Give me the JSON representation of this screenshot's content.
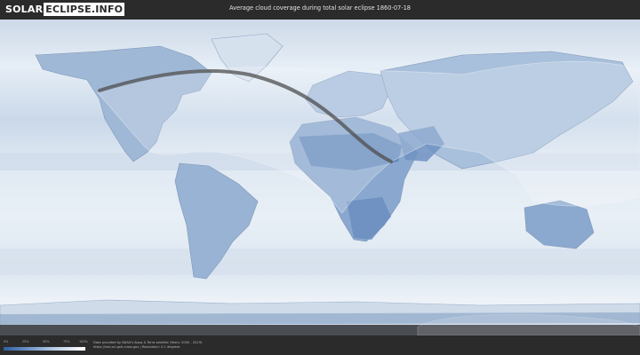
{
  "header": {
    "logo_part1": "SOLAR",
    "logo_part2": "ECLIPSE.INFO",
    "title": "Average cloud coverage during total solar eclipse 1860-07-18"
  },
  "legend": {
    "ticks": [
      "0%",
      "25%",
      "50%",
      "75%",
      "100%"
    ],
    "colors": {
      "low": "#2f5e9e",
      "mid": "#b3c9e2",
      "high": "#ffffff"
    }
  },
  "footer": {
    "credit_line1": "Data provided by NASA's Aqua & Terra satellite (Years: 2000 - 2019)",
    "credit_line2": "https://neo.sci.gsfc.nasa.gov | Resolution: 0.1 degrees"
  },
  "colors": {
    "ocean_cloud": "#dfe9f3",
    "land_clear": "#5f86ba",
    "eclipse_path": "#4e4e4e",
    "header_bg": "#2b2b2b"
  }
}
